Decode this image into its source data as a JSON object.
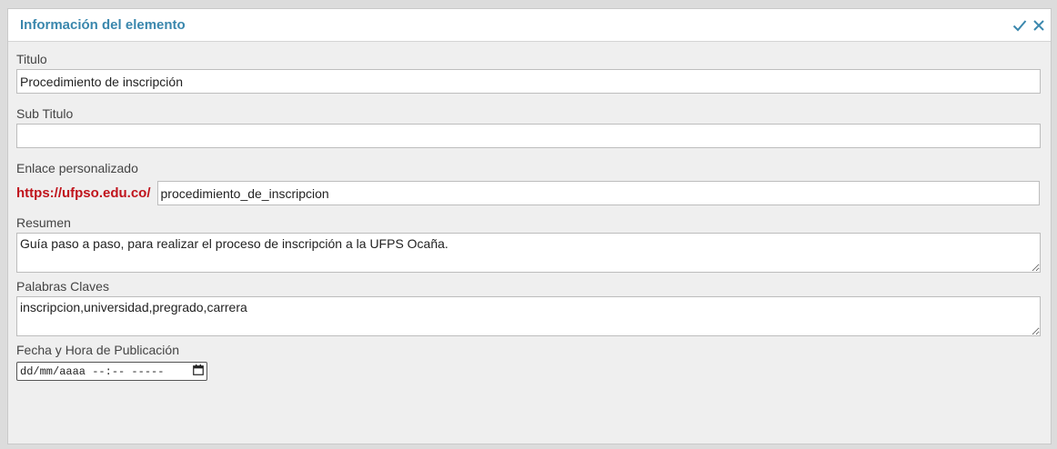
{
  "header": {
    "title": "Información del elemento",
    "confirm_icon": "checkmark-icon",
    "close_icon": "close-icon"
  },
  "fields": {
    "titulo": {
      "label": "Titulo",
      "value": "Procedimiento de inscripción"
    },
    "subtitulo": {
      "label": "Sub Titulo",
      "value": ""
    },
    "enlace": {
      "label": "Enlace personalizado",
      "prefix": "https://ufpso.edu.co/",
      "value": "procedimiento_de_inscripcion"
    },
    "resumen": {
      "label": "Resumen",
      "value": "Guía paso a paso, para realizar el proceso de inscripción a la UFPS Ocaña."
    },
    "palabras": {
      "label": "Palabras Claves",
      "value": "inscripcion,universidad,pregrado,carrera"
    },
    "fecha": {
      "label": "Fecha y Hora de Publicación",
      "placeholder": "dd/mm/aaaa --:-- -----",
      "calendar_icon": "calendar-icon"
    }
  },
  "colors": {
    "title": "#3a87ad",
    "link_prefix": "#c0141c"
  }
}
